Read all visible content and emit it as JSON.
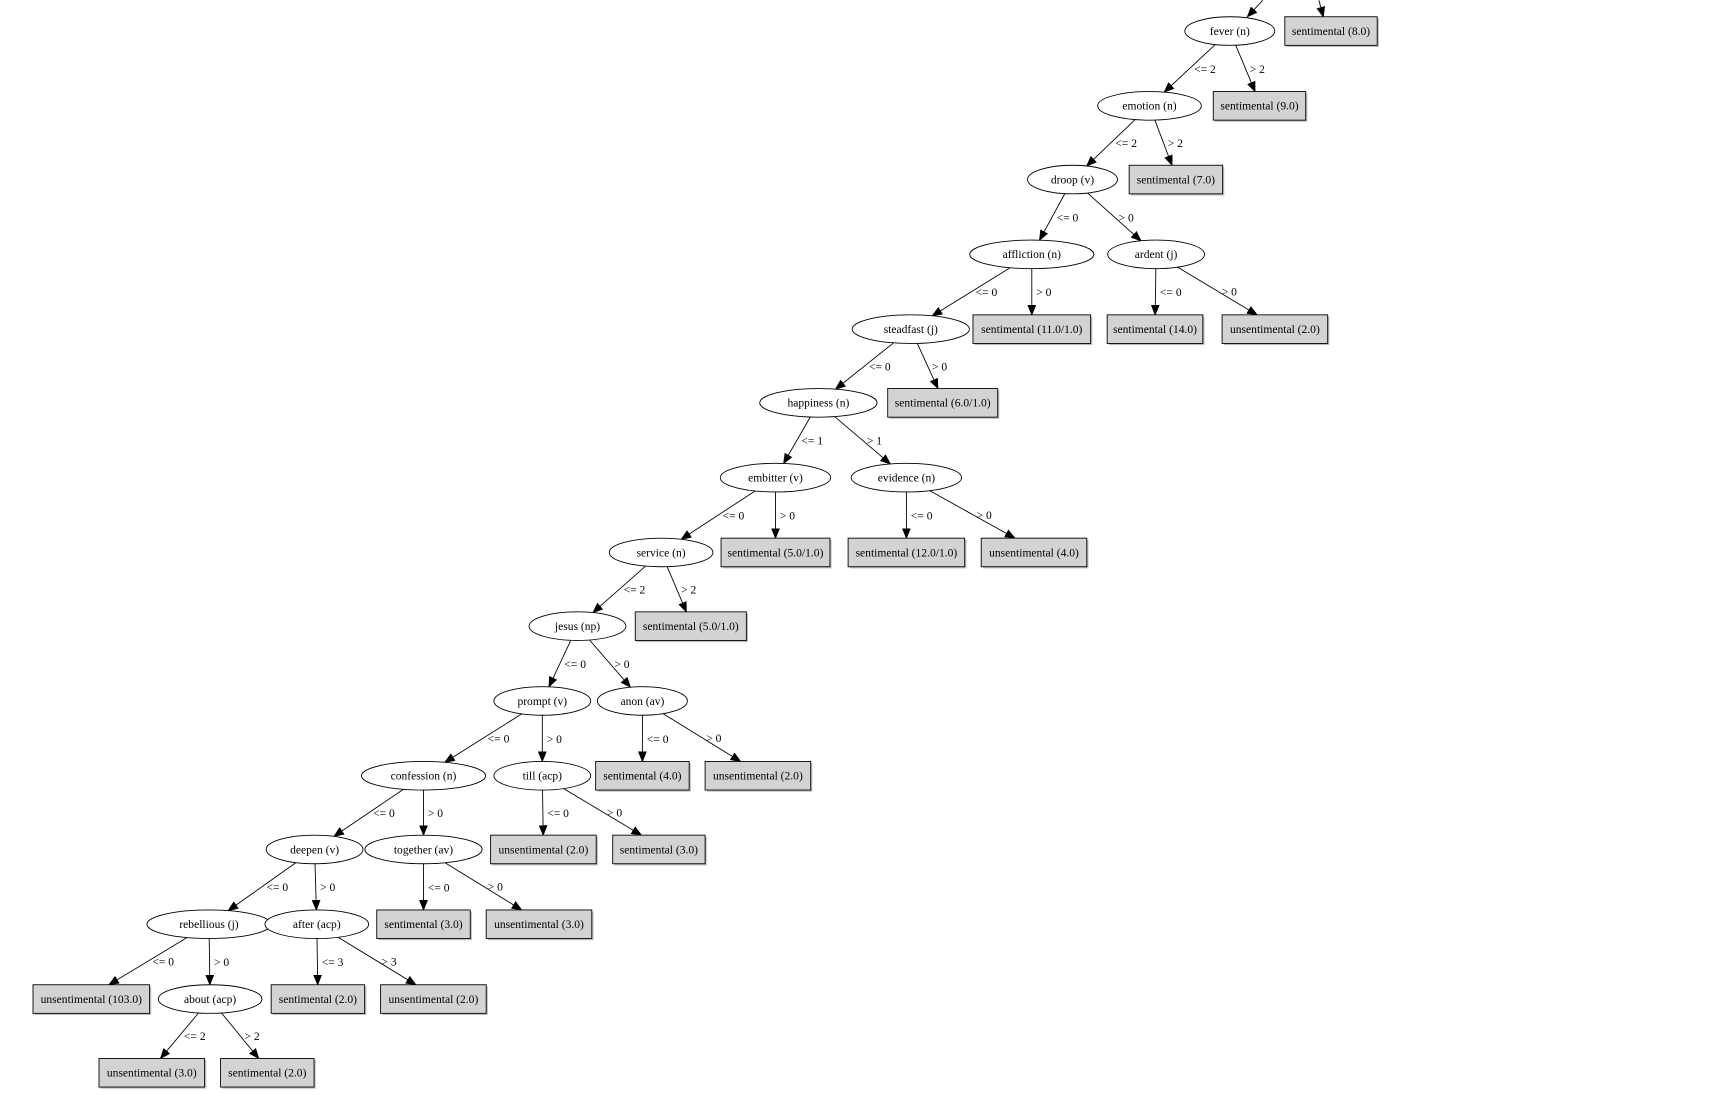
{
  "colors": {
    "leaf_fill": "#d3d3d3",
    "node_fill": "#ffffff",
    "stroke": "#000000"
  },
  "nodes": [
    {
      "id": "fever",
      "label": "fever (n)",
      "type": "split"
    },
    {
      "id": "l_s8",
      "label": "sentimental (8.0)",
      "type": "leaf"
    },
    {
      "id": "emotion",
      "label": "emotion (n)",
      "type": "split"
    },
    {
      "id": "l_s9",
      "label": "sentimental (9.0)",
      "type": "leaf"
    },
    {
      "id": "droop",
      "label": "droop (v)",
      "type": "split"
    },
    {
      "id": "l_s7",
      "label": "sentimental (7.0)",
      "type": "leaf"
    },
    {
      "id": "affliction",
      "label": "affliction (n)",
      "type": "split"
    },
    {
      "id": "ardent",
      "label": "ardent (j)",
      "type": "split"
    },
    {
      "id": "steadfast",
      "label": "steadfast (j)",
      "type": "split"
    },
    {
      "id": "l_s11",
      "label": "sentimental (11.0/1.0)",
      "type": "leaf"
    },
    {
      "id": "l_s14",
      "label": "sentimental (14.0)",
      "type": "leaf"
    },
    {
      "id": "l_u2a",
      "label": "unsentimental (2.0)",
      "type": "leaf"
    },
    {
      "id": "happiness",
      "label": "happiness (n)",
      "type": "split"
    },
    {
      "id": "l_s6",
      "label": "sentimental (6.0/1.0)",
      "type": "leaf"
    },
    {
      "id": "embitter",
      "label": "embitter (v)",
      "type": "split"
    },
    {
      "id": "evidence",
      "label": "evidence (n)",
      "type": "split"
    },
    {
      "id": "service",
      "label": "service (n)",
      "type": "split"
    },
    {
      "id": "l_s5a",
      "label": "sentimental (5.0/1.0)",
      "type": "leaf"
    },
    {
      "id": "l_s12",
      "label": "sentimental (12.0/1.0)",
      "type": "leaf"
    },
    {
      "id": "l_u4",
      "label": "unsentimental (4.0)",
      "type": "leaf"
    },
    {
      "id": "jesus",
      "label": "jesus (np)",
      "type": "split"
    },
    {
      "id": "l_s5b",
      "label": "sentimental (5.0/1.0)",
      "type": "leaf"
    },
    {
      "id": "prompt",
      "label": "prompt (v)",
      "type": "split"
    },
    {
      "id": "anon",
      "label": "anon (av)",
      "type": "split"
    },
    {
      "id": "confession",
      "label": "confession (n)",
      "type": "split"
    },
    {
      "id": "till",
      "label": "till (acp)",
      "type": "split"
    },
    {
      "id": "l_s4",
      "label": "sentimental (4.0)",
      "type": "leaf"
    },
    {
      "id": "l_u2b",
      "label": "unsentimental (2.0)",
      "type": "leaf"
    },
    {
      "id": "deepen",
      "label": "deepen (v)",
      "type": "split"
    },
    {
      "id": "together",
      "label": "together (av)",
      "type": "split"
    },
    {
      "id": "l_u2c",
      "label": "unsentimental (2.0)",
      "type": "leaf"
    },
    {
      "id": "l_s3a",
      "label": "sentimental (3.0)",
      "type": "leaf"
    },
    {
      "id": "rebellious",
      "label": "rebellious (j)",
      "type": "split"
    },
    {
      "id": "after",
      "label": "after (acp)",
      "type": "split"
    },
    {
      "id": "l_s3b",
      "label": "sentimental (3.0)",
      "type": "leaf"
    },
    {
      "id": "l_u3a",
      "label": "unsentimental (3.0)",
      "type": "leaf"
    },
    {
      "id": "l_u103",
      "label": "unsentimental (103.0)",
      "type": "leaf"
    },
    {
      "id": "about",
      "label": "about (acp)",
      "type": "split"
    },
    {
      "id": "l_s2a",
      "label": "sentimental (2.0)",
      "type": "leaf"
    },
    {
      "id": "l_u2d",
      "label": "unsentimental (2.0)",
      "type": "leaf"
    },
    {
      "id": "l_u3b",
      "label": "unsentimental (3.0)",
      "type": "leaf"
    },
    {
      "id": "l_s2b",
      "label": "sentimental (2.0)",
      "type": "leaf"
    }
  ],
  "edges": [
    {
      "from": "fever",
      "to": "emotion",
      "label": "<= 2"
    },
    {
      "from": "fever",
      "to": "l_s9",
      "label": "> 2"
    },
    {
      "from": "emotion",
      "to": "droop",
      "label": "<= 2"
    },
    {
      "from": "emotion",
      "to": "l_s7",
      "label": "> 2"
    },
    {
      "from": "droop",
      "to": "affliction",
      "label": "<= 0"
    },
    {
      "from": "droop",
      "to": "ardent",
      "label": "> 0"
    },
    {
      "from": "affliction",
      "to": "steadfast",
      "label": "<= 0"
    },
    {
      "from": "affliction",
      "to": "l_s11",
      "label": "> 0"
    },
    {
      "from": "ardent",
      "to": "l_s14",
      "label": "<= 0"
    },
    {
      "from": "ardent",
      "to": "l_u2a",
      "label": "> 0"
    },
    {
      "from": "steadfast",
      "to": "happiness",
      "label": "<= 0"
    },
    {
      "from": "steadfast",
      "to": "l_s6",
      "label": "> 0"
    },
    {
      "from": "happiness",
      "to": "embitter",
      "label": "<= 1"
    },
    {
      "from": "happiness",
      "to": "evidence",
      "label": "> 1"
    },
    {
      "from": "embitter",
      "to": "service",
      "label": "<= 0"
    },
    {
      "from": "embitter",
      "to": "l_s5a",
      "label": "> 0"
    },
    {
      "from": "evidence",
      "to": "l_s12",
      "label": "<= 0"
    },
    {
      "from": "evidence",
      "to": "l_u4",
      "label": "> 0"
    },
    {
      "from": "service",
      "to": "jesus",
      "label": "<= 2"
    },
    {
      "from": "service",
      "to": "l_s5b",
      "label": "> 2"
    },
    {
      "from": "jesus",
      "to": "prompt",
      "label": "<= 0"
    },
    {
      "from": "jesus",
      "to": "anon",
      "label": "> 0"
    },
    {
      "from": "prompt",
      "to": "confession",
      "label": "<= 0"
    },
    {
      "from": "prompt",
      "to": "till",
      "label": "> 0"
    },
    {
      "from": "anon",
      "to": "l_s4",
      "label": "<= 0"
    },
    {
      "from": "anon",
      "to": "l_u2b",
      "label": "> 0"
    },
    {
      "from": "confession",
      "to": "deepen",
      "label": "<= 0"
    },
    {
      "from": "confession",
      "to": "together",
      "label": "> 0"
    },
    {
      "from": "till",
      "to": "l_u2c",
      "label": "<= 0"
    },
    {
      "from": "till",
      "to": "l_s3a",
      "label": "> 0"
    },
    {
      "from": "deepen",
      "to": "rebellious",
      "label": "<= 0"
    },
    {
      "from": "deepen",
      "to": "after",
      "label": "> 0"
    },
    {
      "from": "together",
      "to": "l_s3b",
      "label": "<= 0"
    },
    {
      "from": "together",
      "to": "l_u3a",
      "label": "> 0"
    },
    {
      "from": "rebellious",
      "to": "l_u103",
      "label": "<= 0"
    },
    {
      "from": "rebellious",
      "to": "about",
      "label": "> 0"
    },
    {
      "from": "after",
      "to": "l_s2a",
      "label": "<= 3"
    },
    {
      "from": "after",
      "to": "l_u2d",
      "label": "> 3"
    },
    {
      "from": "about",
      "to": "l_u3b",
      "label": "<= 2"
    },
    {
      "from": "about",
      "to": "l_s2b",
      "label": "> 2"
    }
  ]
}
